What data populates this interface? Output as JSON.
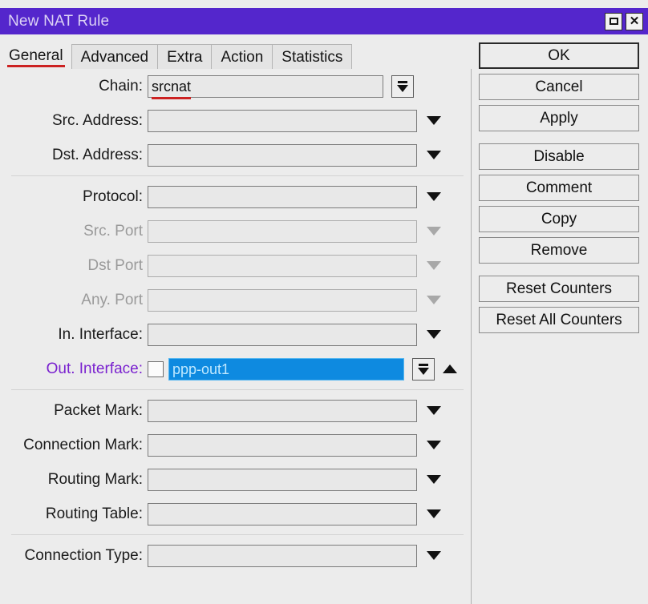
{
  "window": {
    "title": "New NAT Rule",
    "controls": [
      {
        "name": "restore-button",
        "label": ""
      },
      {
        "name": "close-button",
        "label": "✕"
      }
    ]
  },
  "colors": {
    "titlebar": "#5426cc",
    "title_text": "#dcd2f5",
    "accent_underline": "#cc2222",
    "selected_field_bg": "#0e8ae0",
    "selected_field_text": "#bfe8ff",
    "accent_label": "#7a22cf",
    "panel_bg": "#ececec",
    "disabled_text": "#9a9a9a"
  },
  "tabs": [
    {
      "label": "General",
      "active": true
    },
    {
      "label": "Advanced",
      "active": false
    },
    {
      "label": "Extra",
      "active": false
    },
    {
      "label": "Action",
      "active": false
    },
    {
      "label": "Statistics",
      "active": false
    }
  ],
  "form": {
    "rows": [
      {
        "label": "Chain:",
        "value": "srcnat",
        "placeholder": ""
      },
      {
        "label": "Src. Address:",
        "value": "",
        "placeholder": ""
      },
      {
        "label": "Dst. Address:",
        "value": "",
        "placeholder": ""
      },
      {
        "label": "Protocol:",
        "value": "",
        "placeholder": ""
      },
      {
        "label": "Src. Port",
        "value": "",
        "placeholder": ""
      },
      {
        "label": "Dst Port",
        "value": "",
        "placeholder": ""
      },
      {
        "label": "Any. Port",
        "value": "",
        "placeholder": ""
      },
      {
        "label": "In. Interface:",
        "value": "",
        "placeholder": ""
      },
      {
        "label": "Out. Interface:",
        "value": "ppp-out1",
        "placeholder": ""
      },
      {
        "label": "Packet Mark:",
        "value": "",
        "placeholder": ""
      },
      {
        "label": "Connection Mark:",
        "value": "",
        "placeholder": ""
      },
      {
        "label": "Routing Mark:",
        "value": "",
        "placeholder": ""
      },
      {
        "label": "Routing Table:",
        "value": "",
        "placeholder": ""
      },
      {
        "label": "Connection Type:",
        "value": "",
        "placeholder": ""
      }
    ]
  },
  "buttons": [
    {
      "label": "OK",
      "default": true
    },
    {
      "label": "Cancel",
      "default": false
    },
    {
      "label": "Apply",
      "default": false
    },
    {
      "label": "Disable",
      "default": false
    },
    {
      "label": "Comment",
      "default": false
    },
    {
      "label": "Copy",
      "default": false
    },
    {
      "label": "Remove",
      "default": false
    },
    {
      "label": "Reset Counters",
      "default": false
    },
    {
      "label": "Reset All Counters",
      "default": false
    }
  ]
}
